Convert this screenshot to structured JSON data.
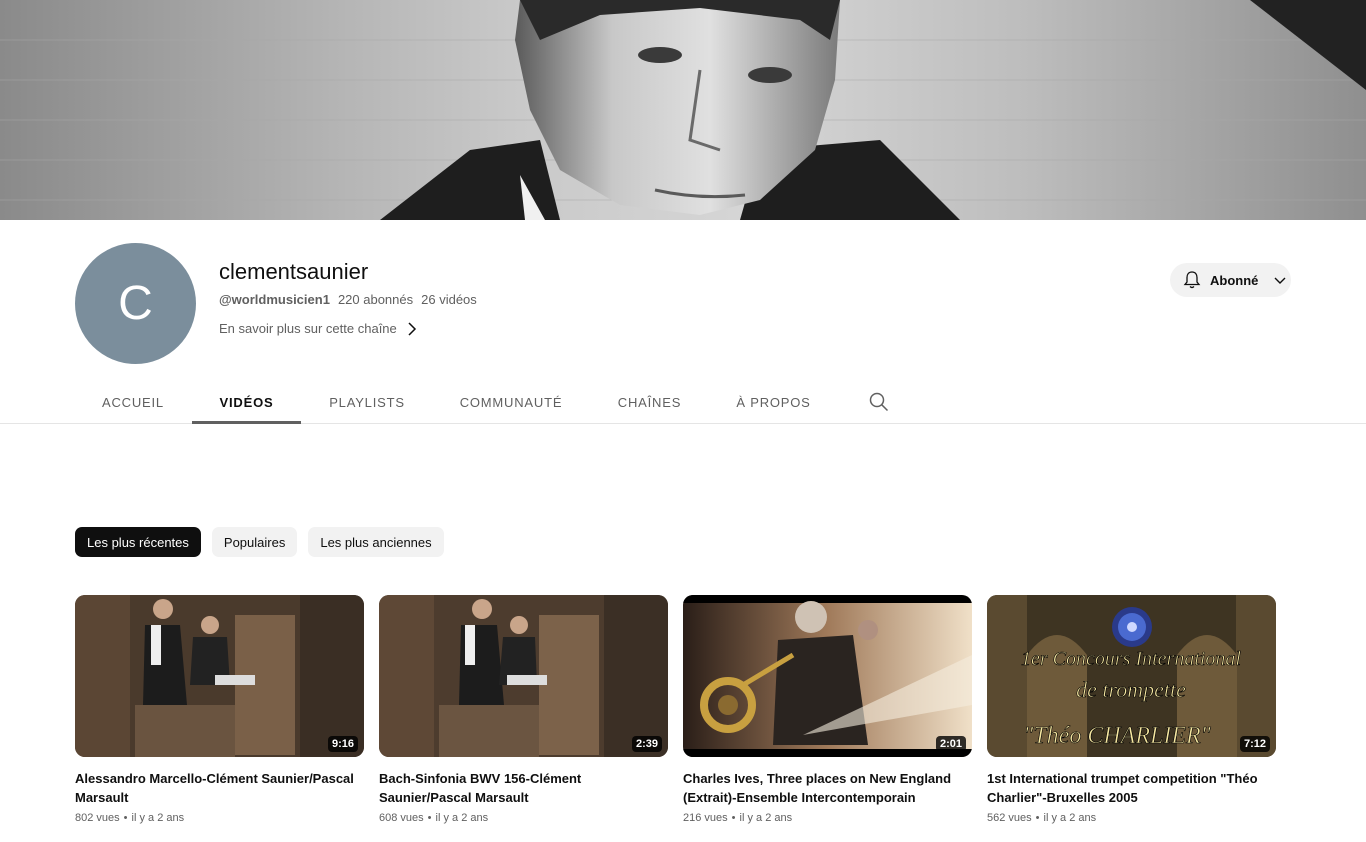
{
  "channel": {
    "avatar_letter": "C",
    "name": "clementsaunier",
    "handle": "@worldmusicien1",
    "subscribers": "220 abonnés",
    "video_count": "26 vidéos",
    "about_link": "En savoir plus sur cette chaîne",
    "subscribe_label": "Abonné"
  },
  "tabs": [
    {
      "label": "ACCUEIL"
    },
    {
      "label": "VIDÉOS"
    },
    {
      "label": "PLAYLISTS"
    },
    {
      "label": "COMMUNAUTÉ"
    },
    {
      "label": "CHAÎNES"
    },
    {
      "label": "À PROPOS"
    }
  ],
  "active_tab": "VIDÉOS",
  "chips": [
    {
      "label": "Les plus récentes"
    },
    {
      "label": "Populaires"
    },
    {
      "label": "Les plus anciennes"
    }
  ],
  "videos": [
    {
      "title": "Alessandro Marcello-Clément Saunier/Pascal Marsault",
      "duration": "9:16",
      "views": "802 vues",
      "age": "il y a 2 ans"
    },
    {
      "title": "Bach-Sinfonia BWV 156-Clément Saunier/Pascal Marsault",
      "duration": "2:39",
      "views": "608 vues",
      "age": "il y a 2 ans"
    },
    {
      "title": "Charles Ives, Three places on New England (Extrait)-Ensemble Intercontemporain",
      "duration": "2:01",
      "views": "216 vues",
      "age": "il y a 2 ans"
    },
    {
      "title": "1st International trumpet competition \"Théo Charlier\"-Bruxelles 2005",
      "duration": "7:12",
      "views": "562 vues",
      "age": "il y a 2 ans",
      "thumb_text": [
        "1er Concours International",
        "de trompette",
        "\"Théo CHARLIER\""
      ]
    }
  ],
  "colors": {
    "avatar_bg": "#7b8e9c",
    "chip_active_bg": "#0f0f0f",
    "chip_bg": "#f2f2f2",
    "secondary_text": "#606060"
  },
  "icons": [
    "bell-icon",
    "chevron-down-icon",
    "chevron-right-icon",
    "search-icon"
  ]
}
